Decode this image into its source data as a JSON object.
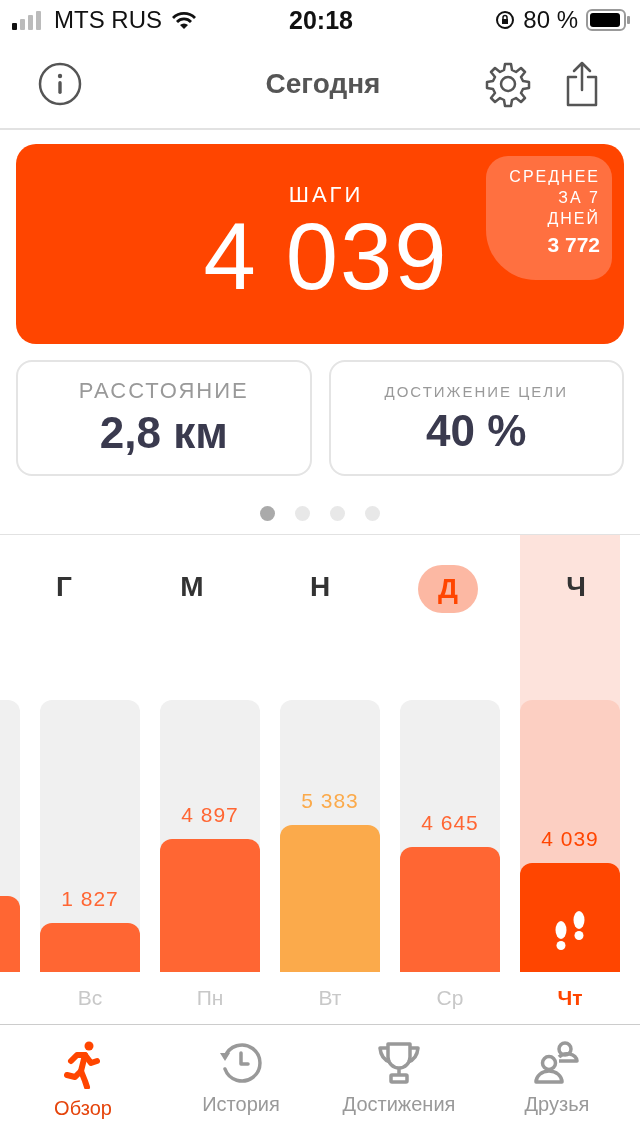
{
  "status_bar": {
    "carrier": "MTS RUS",
    "time": "20:18",
    "battery": "80 %"
  },
  "nav": {
    "title": "Сегодня"
  },
  "steps_card": {
    "label": "ШАГИ",
    "value": "4 039",
    "average_label": "СРЕДНЕЕ ЗА 7 ДНЕЙ",
    "average_value": "3 772"
  },
  "stat_cards": [
    {
      "label": "РАССТОЯНИЕ",
      "value": "2,8 км"
    },
    {
      "label": "ДОСТИЖЕНИЕ ЦЕЛИ",
      "value": "40 %"
    }
  ],
  "page_dots": [
    {
      "selected": true
    },
    {
      "selected": false
    },
    {
      "selected": false
    },
    {
      "selected": false
    }
  ],
  "week_letters": [
    {
      "label": "Г",
      "selected": false
    },
    {
      "label": "М",
      "selected": false
    },
    {
      "label": "Н",
      "selected": false
    },
    {
      "label": "Д",
      "selected": true
    },
    {
      "label": "Ч",
      "selected": false
    }
  ],
  "days": [
    {
      "level": 0.28,
      "color": "#ff6633",
      "selected": false
    },
    {
      "label": "Вс",
      "value": "1 827",
      "level": 0.18,
      "color": "#ff6633",
      "selected": false
    },
    {
      "label": "Пн",
      "value": "4 897",
      "level": 0.49,
      "color": "#ff6633",
      "selected": false
    },
    {
      "label": "Вт",
      "value": "5 383",
      "level": 0.54,
      "color": "#fbaa4b",
      "selected": false
    },
    {
      "label": "Ср",
      "value": "4 645",
      "level": 0.46,
      "color": "#ff6633",
      "selected": false
    },
    {
      "label": "Чт",
      "value": "4 039",
      "level": 0.4,
      "color": "#ff4500",
      "selected": true
    }
  ],
  "tabs": [
    {
      "label": "Обзор",
      "kind": "overview",
      "selected": true
    },
    {
      "label": "История",
      "kind": "history",
      "selected": false
    },
    {
      "label": "Достижения",
      "kind": "achievements",
      "selected": false
    },
    {
      "label": "Друзья",
      "kind": "friends",
      "selected": false
    }
  ]
}
